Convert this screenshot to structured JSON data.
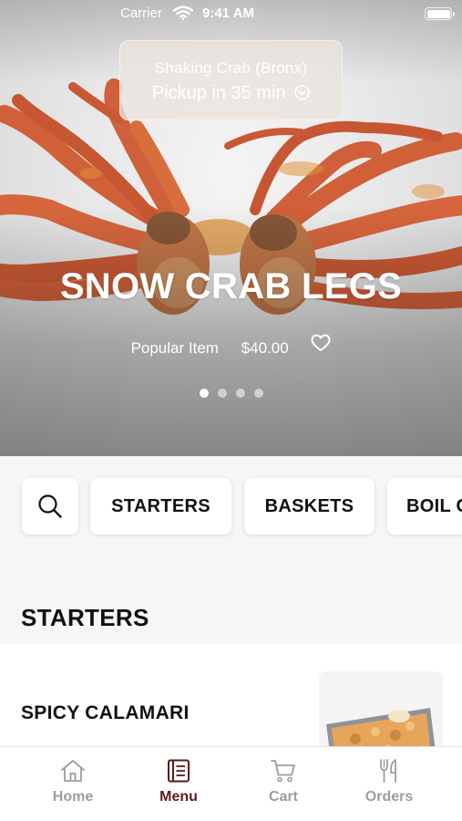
{
  "status_bar": {
    "carrier": "Carrier",
    "time": "9:41 AM"
  },
  "pickup": {
    "store_name": "Shaking Crab (Bronx)",
    "eta": "Pickup in 35 min"
  },
  "hero": {
    "title": "SNOW CRAB LEGS",
    "badge": "Popular Item",
    "price": "$40.00",
    "slide_count": 4,
    "active_slide": 1
  },
  "categories": {
    "search_icon": "search-icon",
    "items": [
      "STARTERS",
      "BASKETS",
      "BOIL COMBOS"
    ]
  },
  "section": {
    "title": "STARTERS"
  },
  "menu_items": [
    {
      "name": "SPICY CALAMARI"
    }
  ],
  "tabs": [
    {
      "label": "Home",
      "icon": "home-icon",
      "active": false
    },
    {
      "label": "Menu",
      "icon": "menu-book-icon",
      "active": true
    },
    {
      "label": "Cart",
      "icon": "cart-icon",
      "active": false
    },
    {
      "label": "Orders",
      "icon": "fork-knife-icon",
      "active": false
    }
  ],
  "colors": {
    "accent": "#5c1a1a",
    "inactive_tab": "#9d9d9d",
    "crab": "#e0653c"
  }
}
